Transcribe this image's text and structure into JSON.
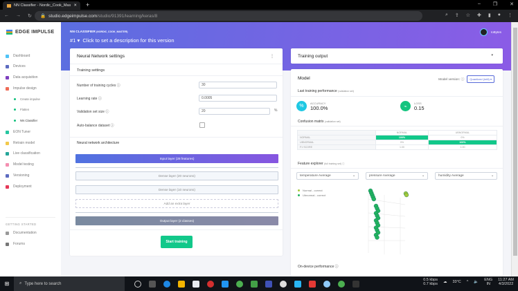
{
  "browser": {
    "tab_title": "NN Classifier - Nordic_Cook_Mas",
    "url_host": "studio.edgeimpulse.com",
    "url_path": "/studio/91391/learning/keras/8"
  },
  "sidebar": {
    "brand": "EDGE IMPULSE",
    "items": [
      {
        "label": "Dashboard",
        "color": "#4fc3f7"
      },
      {
        "label": "Devices",
        "color": "#5c6bc0"
      },
      {
        "label": "Data acquisition",
        "color": "#7e3fbf"
      },
      {
        "label": "Impulse design",
        "color": "#ef6c57"
      },
      {
        "label": "Create impulse",
        "sub": true
      },
      {
        "label": "Flatten",
        "sub": true
      },
      {
        "label": "NN Classifier",
        "sub": true,
        "active": true
      },
      {
        "label": "EON Tuner",
        "color": "#26c6a0"
      },
      {
        "label": "Retrain model",
        "color": "#f2c94c"
      },
      {
        "label": "Live classification",
        "color": "#26a69a"
      },
      {
        "label": "Model testing",
        "color": "#f48fb1"
      },
      {
        "label": "Versioning",
        "color": "#5c6bc0"
      },
      {
        "label": "Deployment",
        "color": "#e53958"
      }
    ],
    "getting_started": "GETTING STARTED",
    "links": [
      {
        "label": "Documentation"
      },
      {
        "label": "Forums"
      }
    ]
  },
  "header": {
    "subtitle": "NN CLASSIFIER",
    "subtitle_small": "(NORDIC_COOK_MASTER)",
    "version": "#1",
    "description": "Click to set a description for this version",
    "user": "IoBytes"
  },
  "nn": {
    "title": "Neural Network settings",
    "training_settings": "Training settings",
    "fields": [
      {
        "label": "Number of training cycles ⓘ",
        "value": "30"
      },
      {
        "label": "Learning rate ⓘ",
        "value": "0.0005"
      },
      {
        "label": "Validation set size ⓘ",
        "value": "20",
        "unit": "%"
      },
      {
        "label": "Auto-balance dataset ⓘ",
        "checked": false
      }
    ],
    "architecture": "Neural network architecture",
    "layers": {
      "input": "Input layer (28 features)",
      "dense1": "Dense layer (20 neurons)",
      "dense2": "Dense layer (10 neurons)",
      "add": "Add an extra layer",
      "output": "Output layer (2 classes)"
    },
    "start": "Start training"
  },
  "output": {
    "title": "Training output",
    "model": "Model",
    "model_version_label": "Model version: ⓘ",
    "model_version": "Quantized (int8) ▾",
    "last_perf": "Last training performance",
    "last_perf_small": "(validation set)",
    "accuracy_label": "ACCURACY",
    "accuracy": "100.0%",
    "loss_label": "LOSS",
    "loss": "0.15",
    "cm_title": "Confusion matrix",
    "cm_small": "(validation set)",
    "cm": {
      "headers": [
        "",
        "NORMAL",
        "UBNORMAL"
      ],
      "rows": [
        [
          "NORMAL",
          "100%",
          "0%"
        ],
        [
          "UBNORMAL",
          "0%",
          "100%"
        ],
        [
          "F1 SCORE",
          "1.00",
          "1.00"
        ]
      ]
    },
    "fe_title": "Feature explorer",
    "fe_small": "(full training set) ⓘ",
    "axes": [
      "temperature Average",
      "pressure Average",
      "humidity Average"
    ],
    "legend": [
      {
        "label": "Normal - correct",
        "color": "#a5c93a"
      },
      {
        "label": "Ubnormal - correct",
        "color": "#22b35e"
      }
    ],
    "on_device": "On-device performance ⓘ"
  },
  "taskbar": {
    "search": "Type here to search",
    "net_up": "0.5 kbps",
    "net_down": "0.7 kbps",
    "temp": "33°C",
    "lang": "ENG",
    "region": "IN",
    "time": "11:27 AM",
    "date": "4/3/2022"
  }
}
